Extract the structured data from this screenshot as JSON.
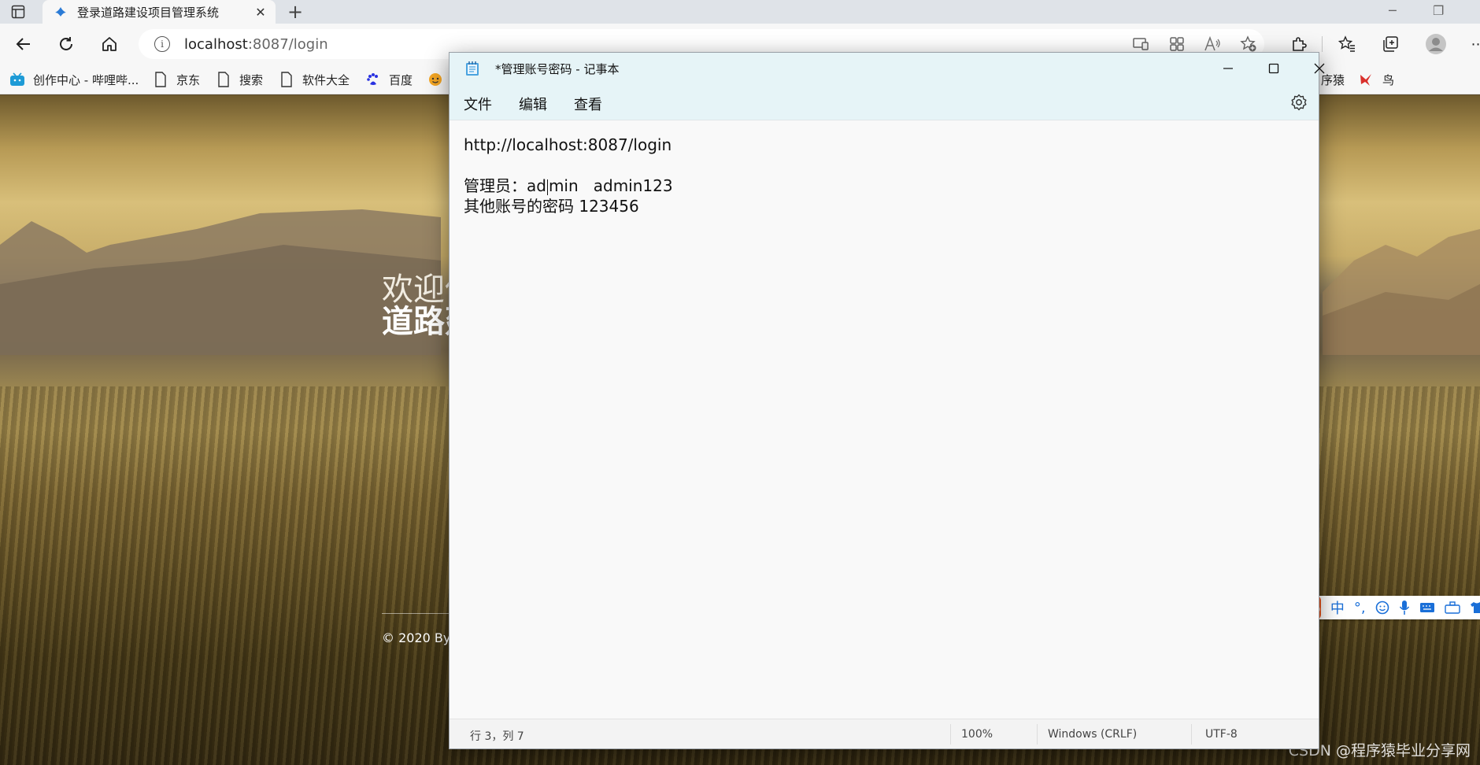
{
  "browser": {
    "tab_title": "登录道路建设项目管理系统",
    "url_host": "localhost",
    "url_rest": ":8087/login",
    "bookmarks": [
      {
        "label": "创作中心 - 哔哩哔...",
        "icon": "bilibili-icon"
      },
      {
        "label": "京东",
        "icon": "page-icon"
      },
      {
        "label": "搜索",
        "icon": "page-icon"
      },
      {
        "label": "软件大全",
        "icon": "page-icon"
      },
      {
        "label": "百度",
        "icon": "baidu-paw-icon"
      },
      {
        "label": "序猿",
        "icon": "page-icon"
      },
      {
        "label": "鸟",
        "icon": "bird-icon"
      }
    ]
  },
  "webpage": {
    "welcome_line1": "欢迎使",
    "welcome_line2": "道路建",
    "copyright": "© 2020 By",
    "watermark": "CSDN @程序猿毕业分享网"
  },
  "ime": {
    "logo": "S",
    "mode": "中",
    "punct": "°,"
  },
  "notepad": {
    "title": "*管理账号密码 - 记事本",
    "menu": [
      "文件",
      "编辑",
      "查看"
    ],
    "lines": [
      "http://localhost:8087/login",
      "",
      "管理员：admin   admin123",
      "其他账号的密码 123456"
    ],
    "line3_before_caret": "管理员：ad",
    "line3_after_caret": "min   admin123",
    "status": {
      "position": "行 3，列 7",
      "zoom": "100%",
      "line_ending": "Windows (CRLF)",
      "encoding": "UTF-8"
    }
  },
  "colors": {
    "notepad_titlebar": "#e6f4f7",
    "ime_logo": "#e8551d",
    "ime_accent": "#1a6fd8"
  }
}
